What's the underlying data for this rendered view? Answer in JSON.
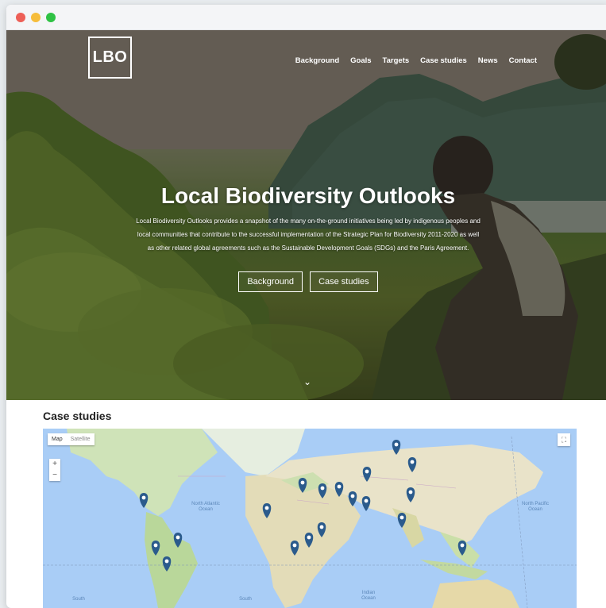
{
  "window": {
    "controls": [
      "close",
      "minimize",
      "maximize"
    ]
  },
  "header": {
    "logo": "LBO",
    "nav": [
      "Background",
      "Goals",
      "Targets",
      "Case studies",
      "News",
      "Contact"
    ]
  },
  "hero": {
    "title": "Local Biodiversity Outlooks",
    "description": "Local Biodiversity Outlooks provides a snapshot of the many on-the-ground initiatives being led by indigenous peoples and local communities that contribute to the successful implementation of the Strategic Plan for Biodiversity 2011-2020 as well as other related global agreements such as the Sustainable Development Goals (SDGs) and the Paris Agreement.",
    "buttons": [
      "Background",
      "Case studies"
    ],
    "scroll_icon": "chevron-down-icon"
  },
  "case_studies": {
    "title": "Case studies",
    "map": {
      "type_controls": {
        "map": "Map",
        "satellite": "Satellite"
      },
      "zoom_in": "+",
      "zoom_out": "−",
      "fullscreen_icon": "fullscreen-icon",
      "ocean_labels": [
        "North Atlantic Ocean",
        "North Pacific Ocean",
        "South",
        "South",
        "Indian Ocean"
      ],
      "marker_color": "#2b5b8c",
      "marker_count": 20
    }
  }
}
